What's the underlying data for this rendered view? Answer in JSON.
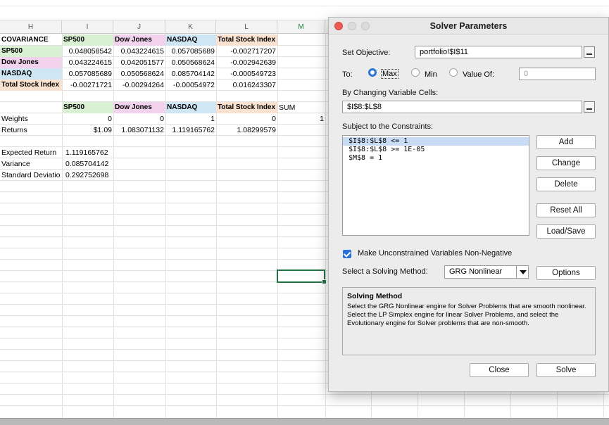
{
  "sheet": {
    "columns": [
      "H",
      "I",
      "J",
      "K",
      "L",
      "M"
    ],
    "covariance": {
      "header": [
        "COVARIANCE",
        "SP500",
        "Dow Jones",
        "NASDAQ",
        "Total Stock Index"
      ],
      "rows": [
        [
          "SP500",
          "0.048058542",
          "0.043224615",
          "0.057085689",
          "-0.002717207"
        ],
        [
          "Dow Jones",
          "0.043224615",
          "0.042051577",
          "0.050568624",
          "-0.002942639"
        ],
        [
          "NASDAQ",
          "0.057085689",
          "0.050568624",
          "0.085704142",
          "-0.000549723"
        ],
        [
          "Total Stock Index",
          "-0.00271721",
          "-0.00294264",
          "-0.00054972",
          "0.016243307"
        ]
      ]
    },
    "portfolio_header": [
      "SP500",
      "Dow Jones",
      "NASDAQ",
      "Total Stock Index",
      "SUM"
    ],
    "weights": {
      "label": "Weights",
      "values": [
        "0",
        "0",
        "1",
        "0",
        "1"
      ]
    },
    "returns": {
      "label": "Returns",
      "values": [
        "$1.09",
        "1.083071132",
        "1.119165762",
        "1.08299579"
      ]
    },
    "stats": [
      {
        "label": "Expected Return",
        "value": "1.119165762"
      },
      {
        "label": "Variance",
        "value": "0.085704142"
      },
      {
        "label": "Standard Deviatio",
        "value": "0.292752698"
      }
    ],
    "colors": {
      "sp500": "#d9f0d3",
      "dowjones": "#f3d2ee",
      "nasdaq": "#cfe7f5",
      "total": "#fbe1cf",
      "selection": "#217346"
    }
  },
  "dialog": {
    "title": "Solver Parameters",
    "set_objective_label": "Set Objective:",
    "objective_value": "portfolio!$I$11",
    "to_label": "To:",
    "options": {
      "max": "Max",
      "min": "Min",
      "value_of": "Value Of:"
    },
    "selected_option": "Max",
    "value_of_field": "0",
    "changing_label": "By Changing Variable Cells:",
    "changing_value": "$I$8:$L$8",
    "constraints_label": "Subject to the Constraints:",
    "constraints": [
      "$I$8:$L$8 <= 1",
      "$I$8:$L$8 >= 1E-05",
      "$M$8 = 1"
    ],
    "buttons": {
      "add": "Add",
      "change": "Change",
      "delete": "Delete",
      "reset_all": "Reset All",
      "load_save": "Load/Save",
      "options": "Options",
      "close": "Close",
      "solve": "Solve"
    },
    "nonneg_label": "Make Unconstrained Variables Non-Negative",
    "nonneg_checked": true,
    "method_label": "Select a Solving Method:",
    "method_value": "GRG Nonlinear",
    "solving_method_heading": "Solving Method",
    "solving_method_text": "Select the GRG Nonlinear engine for Solver Problems that are smooth nonlinear. Select the LP Simplex engine for linear Solver Problems, and select the Evolutionary engine for Solver problems that are non-smooth."
  }
}
